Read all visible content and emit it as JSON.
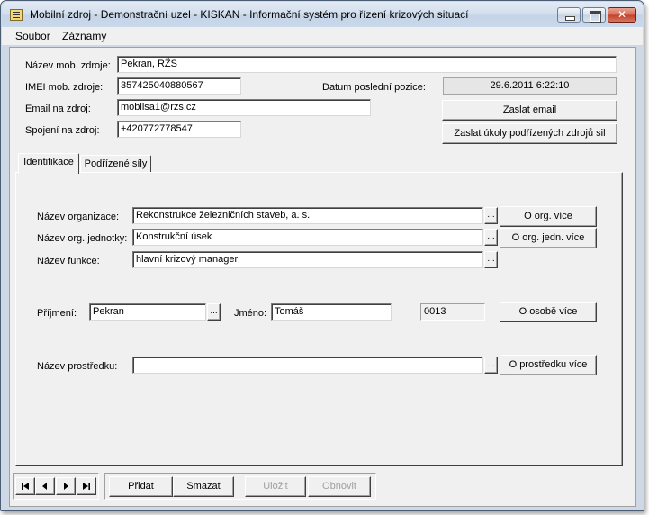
{
  "window": {
    "title": "Mobilní zdroj - Demonstrační uzel - KISKAN - Informační systém pro řízení krizových situací"
  },
  "menu": {
    "items": [
      "Soubor",
      "Záznamy"
    ]
  },
  "header": {
    "name_label": "Název mob. zdroje:",
    "name_value": "Pekran, RŽS",
    "imei_label": "IMEI mob. zdroje:",
    "imei_value": "357425040880567",
    "last_pos_label": "Datum poslední pozice:",
    "last_pos_value": "29.6.2011 6:22:10",
    "email_label": "Email na zdroj:",
    "email_value": "mobilsa1@rzs.cz",
    "phone_label": "Spojení na zdroj:",
    "phone_value": "+420772778547",
    "send_email_button": "Zaslat email",
    "send_tasks_button": "Zaslat úkoly podřízených zdrojů sil"
  },
  "tabs": [
    {
      "label": "Identifikace",
      "active": true
    },
    {
      "label": "Podřízené síly",
      "active": false
    }
  ],
  "identification": {
    "org_label": "Název organizace:",
    "org_value": "Rekonstrukce železničních staveb, a. s.",
    "org_more_button": "O org. více",
    "unit_label": "Název org. jednotky:",
    "unit_value": "Konstrukční úsek",
    "unit_more_button": "O org. jedn. více",
    "function_label": "Název funkce:",
    "function_value": "hlavní krizový manager",
    "surname_label": "Příjmení:",
    "surname_value": "Pekran",
    "firstname_label": "Jméno:",
    "firstname_value": "Tomáš",
    "person_code": "0013",
    "person_more_button": "O osobě více",
    "resource_label": "Název prostředku:",
    "resource_value": "",
    "resource_more_button": "O prostředku více",
    "ellipsis": "..."
  },
  "actions": {
    "add": "Přidat",
    "delete": "Smazat",
    "save": "Uložit",
    "restore": "Obnovit"
  },
  "icons": {
    "nav_first": "first-record-icon",
    "nav_prev": "previous-record-icon",
    "nav_next": "next-record-icon",
    "nav_last": "last-record-icon",
    "app": "form-app-icon"
  },
  "colors": {
    "titlebar": "#cfd9e6",
    "face": "#f0f0f0",
    "close_button": "#c0402a"
  }
}
